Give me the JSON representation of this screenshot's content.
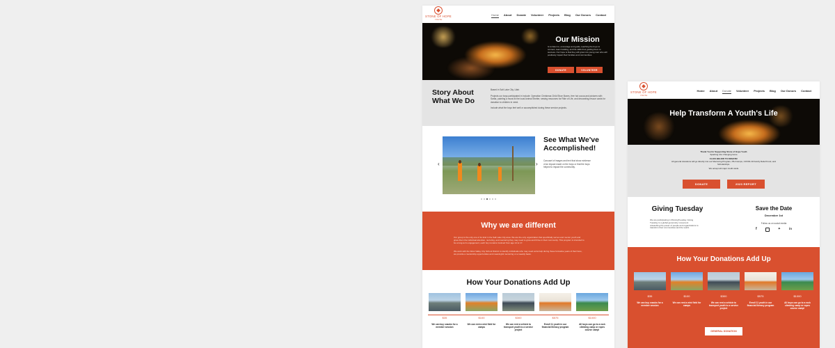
{
  "logo": {
    "name": "STONE OF HOPE",
    "sub": "YOUTH"
  },
  "nav1": [
    "Home",
    "About",
    "Donate",
    "Volunteer",
    "Projects",
    "Blog",
    "Our Donors",
    "Contact"
  ],
  "nav2": [
    "Home",
    "About",
    "Donate",
    "Volunteer",
    "Projects",
    "Blog",
    "Our Donors",
    "Contact"
  ],
  "page1": {
    "mission": {
      "title": "Our Mission",
      "text": "Is to listen to, encourage and guide, teaching the boys to connect, team building, and life skills thus guiding them to success. Our hope is that they will grow into young men who will positively impact their families and communities.",
      "donate": "DONATE",
      "volunteer": "VOLUNTEER"
    },
    "story": {
      "title": "Story About What We Do",
      "p1": "Based in Salt Lake City, Utah",
      "p2": "Projects our boys participated in include: Operation Christmas Child Shoe Boxes, free hot cocoa and pictures with Santa, painting a mural at the local Animal Shelter, sewing resources for Ride of Life, and decorating rescue cards for donation to children in need.",
      "p3": "Include what the boys feel well or accomplished during these service projects."
    },
    "accomplished": {
      "title": "See What We've Accomplished!",
      "text": "Carousel of images and text that show evidence of an impact made on the boys or that the boys helped to impact the community."
    },
    "different": {
      "title": "Why we are different",
      "p1": "Our group is the only one of its kind in the Salt Lake City area. We are the only organization that specifically serves and mentor youth and gives them the individual attention, nurturing, and mentoring they may need to grow and thrive in their community. This program is intended to be a long-term engagement, each boy remains involved from age 14 to 17.",
      "p2": "We work with the West Valley City School District to identify individuals who may need extra help during these formative years of their lives, we provide a mentorship opportunities and meaningful mentoring on a weekly basis."
    },
    "donations": {
      "title": "How Your Donations Add Up",
      "items": [
        {
          "amount": "$35",
          "caption": "We can buy snacks for a member session"
        },
        {
          "amount": "$100",
          "caption": "We can rent a mini field for camps"
        },
        {
          "amount": "$300",
          "caption": "We can rent a vehicle to transport youth to a service project"
        },
        {
          "amount": "$575",
          "caption": "Enroll 11 youth in our financial literacy program"
        },
        {
          "amount": "$1000",
          "caption": "All boys can go to a rock climbing camp or ropes course camp!"
        }
      ]
    }
  },
  "page2": {
    "hero": {
      "title": "Help Transform A Youth's Life"
    },
    "thanks": {
      "l1": "Thank You for Supporting Stone of Hope Youth",
      "l2": "Sparking Life Changing Gone",
      "l3": "CLICK BELOW TO DONATE!",
      "l4": "All general donations will go directly into our Mentoring Program, PIH Camps, COVID-19 Family Relief Fund, and Scholarships.",
      "l5": "We accept all major credit cards",
      "donate": "DONATE",
      "report": "2020 REPORT"
    },
    "giving": {
      "title": "Giving Tuesday",
      "text": "We are participating in #GivingTuesday. Giving Tuesday is a global generosity movement unleashing the power of people and organizations to transform their communities and the world."
    },
    "save": {
      "title": "Save the Date",
      "date": "December 1st",
      "follow": "Follow us on social media"
    },
    "donations": {
      "title": "How Your Donations Add Up",
      "items": [
        {
          "amount": "$35",
          "caption": "We can buy snacks for a member session"
        },
        {
          "amount": "$100",
          "caption": "We can rent a mini field for camps"
        },
        {
          "amount": "$300",
          "caption": "We can rent a vehicle to transport youth to a service project"
        },
        {
          "amount": "$575",
          "caption": "Enroll 11 youth in our financial literacy program"
        },
        {
          "amount": "$1000",
          "caption": "All boys can go to a rock climbing camp or ropes course camp!"
        }
      ],
      "general": "GENERAL DONATION"
    }
  }
}
